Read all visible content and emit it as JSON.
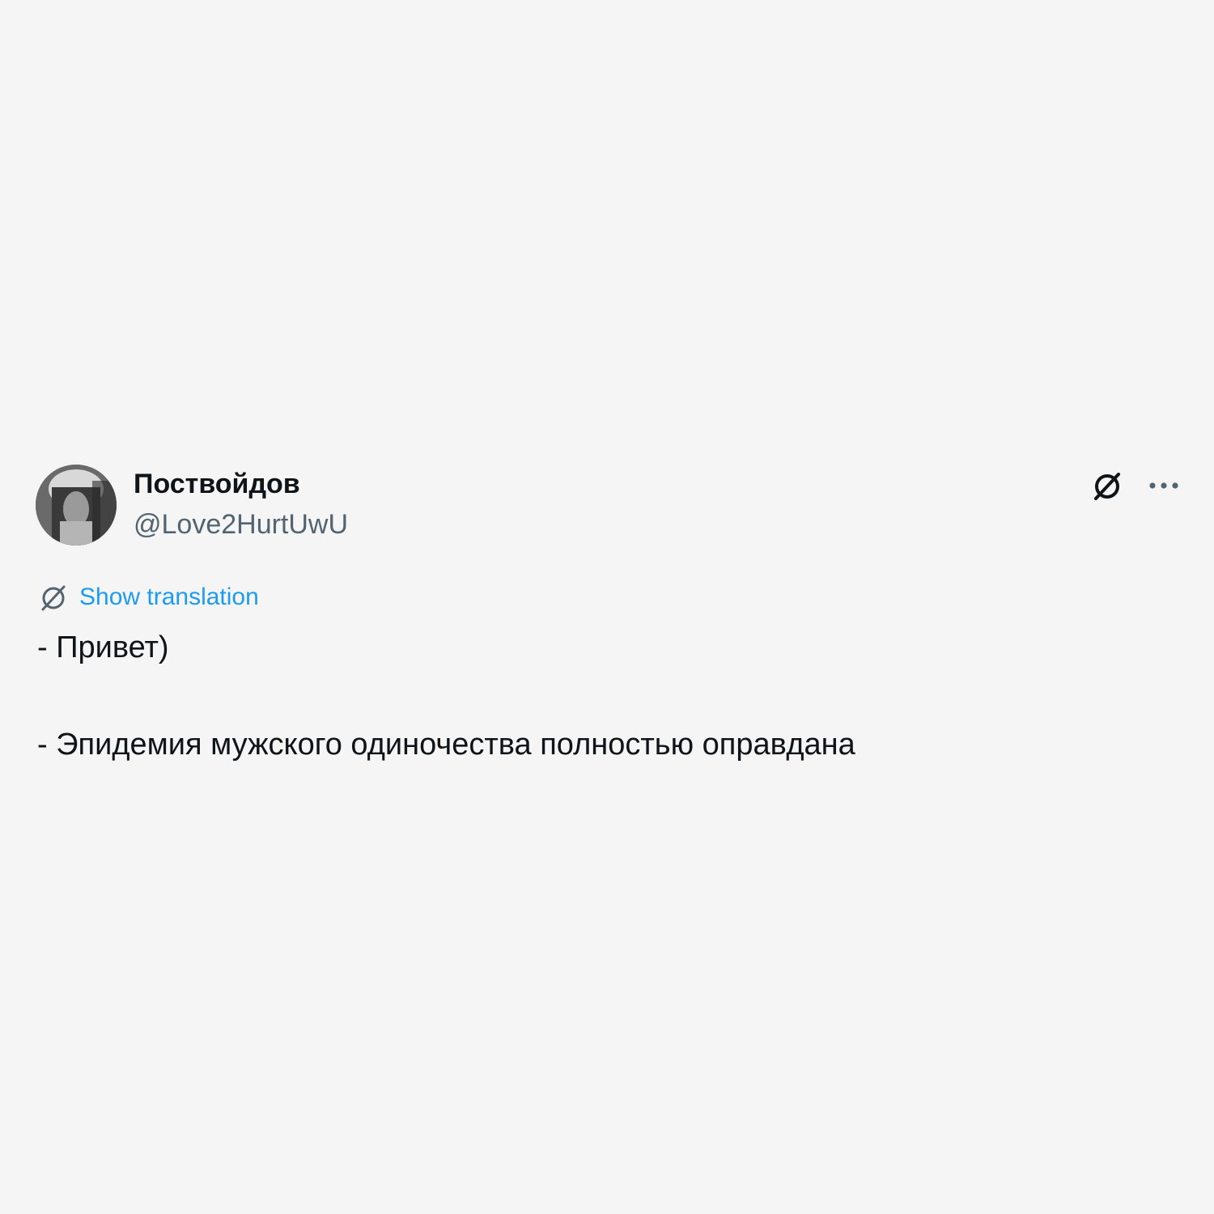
{
  "tweet": {
    "author": {
      "display_name": "Поствойдов",
      "handle": "@Love2HurtUwU",
      "avatar_icon": "avatar-photo"
    },
    "actions": {
      "grok_icon": "grok-icon",
      "more_icon": "more-horizontal-icon"
    },
    "translate": {
      "label": "Show translation",
      "icon": "translate-icon",
      "color": "#1d9bf0"
    },
    "lines": [
      "- Привет)",
      "- Эпидемия мужского одиночества полностью оправдана"
    ]
  },
  "colors": {
    "background": "#f5f5f5",
    "text": "#0f1419",
    "secondary": "#536471",
    "accent": "#1d9bf0"
  }
}
